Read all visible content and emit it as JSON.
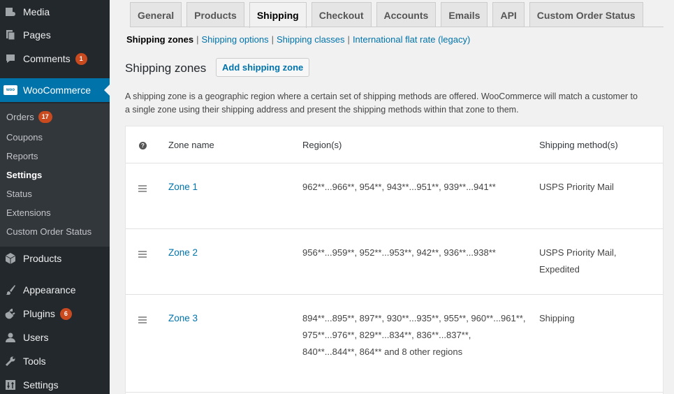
{
  "sidebar": {
    "items": [
      {
        "label": "Media",
        "icon": "media-icon"
      },
      {
        "label": "Pages",
        "icon": "pages-icon"
      },
      {
        "label": "Comments",
        "icon": "comments-icon",
        "badge": "1"
      },
      {
        "label": "WooCommerce",
        "icon": "woocommerce-icon"
      },
      {
        "label": "Products",
        "icon": "products-icon"
      },
      {
        "label": "Appearance",
        "icon": "appearance-icon"
      },
      {
        "label": "Plugins",
        "icon": "plugins-icon",
        "badge": "6"
      },
      {
        "label": "Users",
        "icon": "users-icon"
      },
      {
        "label": "Tools",
        "icon": "tools-icon"
      },
      {
        "label": "Settings",
        "icon": "settings-icon"
      }
    ],
    "woo_logo_text": "woo",
    "submenu": [
      {
        "label": "Orders",
        "badge": "17"
      },
      {
        "label": "Coupons"
      },
      {
        "label": "Reports"
      },
      {
        "label": "Settings",
        "current": true
      },
      {
        "label": "Status"
      },
      {
        "label": "Extensions"
      },
      {
        "label": "Custom Order Status"
      }
    ]
  },
  "tabs": [
    "General",
    "Products",
    "Shipping",
    "Checkout",
    "Accounts",
    "Emails",
    "API",
    "Custom Order Status"
  ],
  "active_tab": "Shipping",
  "subnav": {
    "current": "Shipping zones",
    "links": [
      "Shipping options",
      "Shipping classes",
      "International flat rate (legacy)"
    ],
    "separator": "|"
  },
  "heading": "Shipping zones",
  "add_button": "Add shipping zone",
  "intro": "A shipping zone is a geographic region where a certain set of shipping methods are offered. WooCommerce will match a customer to a single zone using their shipping address and present the shipping methods within that zone to them.",
  "table": {
    "help_icon": "?",
    "headers": {
      "name": "Zone name",
      "regions": "Region(s)",
      "methods": "Shipping method(s)"
    },
    "rows": [
      {
        "name": "Zone 1",
        "regions": "962**...966**, 954**, 943**...951**, 939**...941**",
        "methods": "USPS Priority Mail"
      },
      {
        "name": "Zone 2",
        "regions": "956**...959**, 952**...953**, 942**, 936**...938**",
        "methods": "USPS Priority Mail, Expedited"
      },
      {
        "name": "Zone 3",
        "regions": "894**...895**, 897**, 930**...935**, 955**, 960**...961**, 975**...976**, 829**...834**, 836**...837**, 840**...844**, 864** and 8 other regions",
        "methods": "Shipping"
      }
    ]
  },
  "colors": {
    "sidebar_bg": "#23282d",
    "submenu_bg": "#32373c",
    "accent": "#0073aa",
    "badge": "#ca4a1f"
  }
}
